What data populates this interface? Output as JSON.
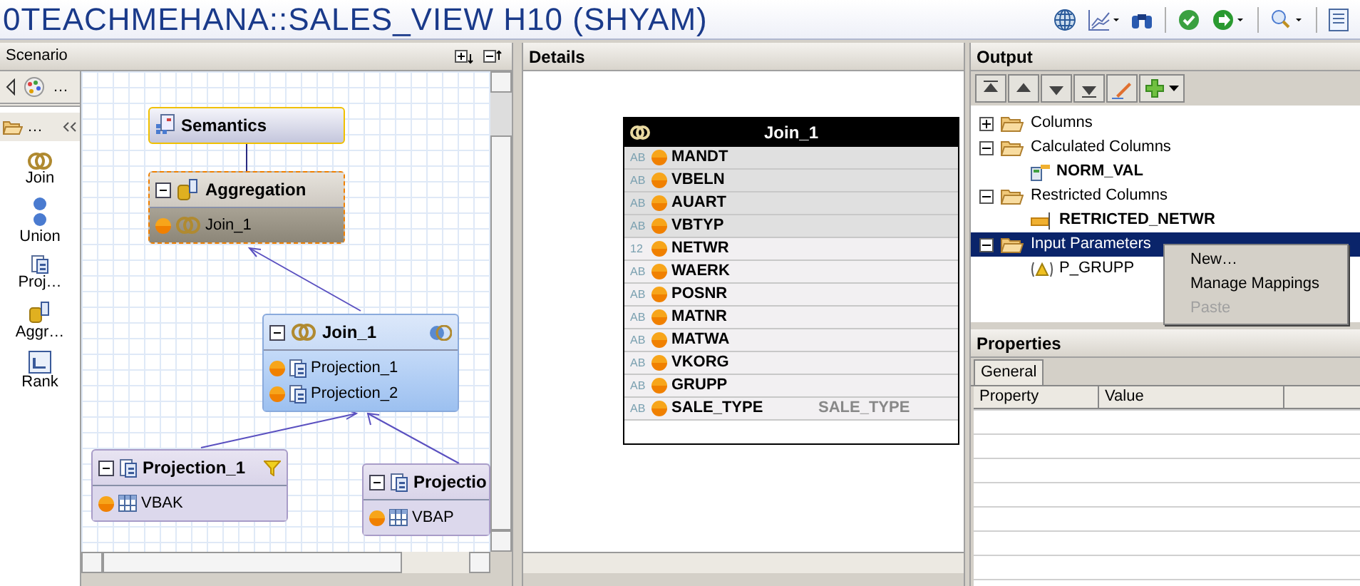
{
  "window": {
    "title": "0TEACHMEHANA::SALES_VIEW H10 (SHYAM)"
  },
  "scenario": {
    "title": "Scenario",
    "palette_more": "…",
    "section": "…",
    "palette": [
      {
        "kind": "join",
        "label": "Join"
      },
      {
        "kind": "union",
        "label": "Union"
      },
      {
        "kind": "projection",
        "label": "Proj…"
      },
      {
        "kind": "aggregation",
        "label": "Aggr…"
      },
      {
        "kind": "rank",
        "label": "Rank"
      }
    ],
    "nodes": [
      {
        "kind": "semantics",
        "title": "Semantics",
        "selected": false
      },
      {
        "kind": "aggregation",
        "title": "Aggregation",
        "selected": true,
        "inputs": [
          {
            "kind": "join",
            "label": "Join_1"
          }
        ]
      },
      {
        "kind": "join",
        "title": "Join_1",
        "selected": false,
        "inputs": [
          {
            "kind": "projection",
            "label": "Projection_1"
          },
          {
            "kind": "projection",
            "label": "Projection_2"
          }
        ]
      },
      {
        "kind": "projection",
        "title": "Projection_1",
        "selected": false,
        "filter": true,
        "inputs": [
          {
            "kind": "table",
            "label": "VBAK"
          }
        ]
      },
      {
        "kind": "projection",
        "title": "Projectio",
        "selected": false,
        "inputs": [
          {
            "kind": "table",
            "label": "VBAP"
          }
        ]
      }
    ]
  },
  "details": {
    "title": "Details",
    "table": {
      "title": "Join_1",
      "fields": [
        {
          "type": "AB",
          "name": "MANDT"
        },
        {
          "type": "AB",
          "name": "VBELN"
        },
        {
          "type": "AB",
          "name": "AUART"
        },
        {
          "type": "AB",
          "name": "VBTYP"
        },
        {
          "type": "12",
          "name": "NETWR"
        },
        {
          "type": "AB",
          "name": "WAERK"
        },
        {
          "type": "AB",
          "name": "POSNR"
        },
        {
          "type": "AB",
          "name": "MATNR"
        },
        {
          "type": "AB",
          "name": "MATWA"
        },
        {
          "type": "AB",
          "name": "VKORG"
        },
        {
          "type": "AB",
          "name": "GRUPP"
        },
        {
          "type": "AB",
          "name": "SALE_TYPE",
          "mapped": "SALE_TYPE"
        }
      ]
    }
  },
  "output": {
    "title": "Output",
    "tree": [
      {
        "label": "Columns",
        "expanded": false,
        "selected": false
      },
      {
        "label": "Calculated Columns",
        "expanded": true,
        "selected": false,
        "children": [
          {
            "kind": "calculated",
            "label": "NORM_VAL",
            "selected": false
          }
        ]
      },
      {
        "label": "Restricted Columns",
        "expanded": true,
        "selected": false,
        "children": [
          {
            "kind": "restricted",
            "label": "RETRICTED_NETWR",
            "selected": false
          }
        ]
      },
      {
        "label": "Input Parameters",
        "expanded": true,
        "selected": true,
        "children": [
          {
            "kind": "parameter",
            "label": "P_GRUPP",
            "selected": false
          }
        ]
      }
    ],
    "context_menu": [
      {
        "label": "New…",
        "disabled": false
      },
      {
        "label": "Manage Mappings",
        "disabled": false
      },
      {
        "label": "Paste",
        "disabled": true
      }
    ]
  },
  "properties": {
    "title": "Properties",
    "tabs": [
      {
        "label": "General",
        "selected": true
      }
    ],
    "columns": [
      "Property",
      "Value"
    ]
  }
}
